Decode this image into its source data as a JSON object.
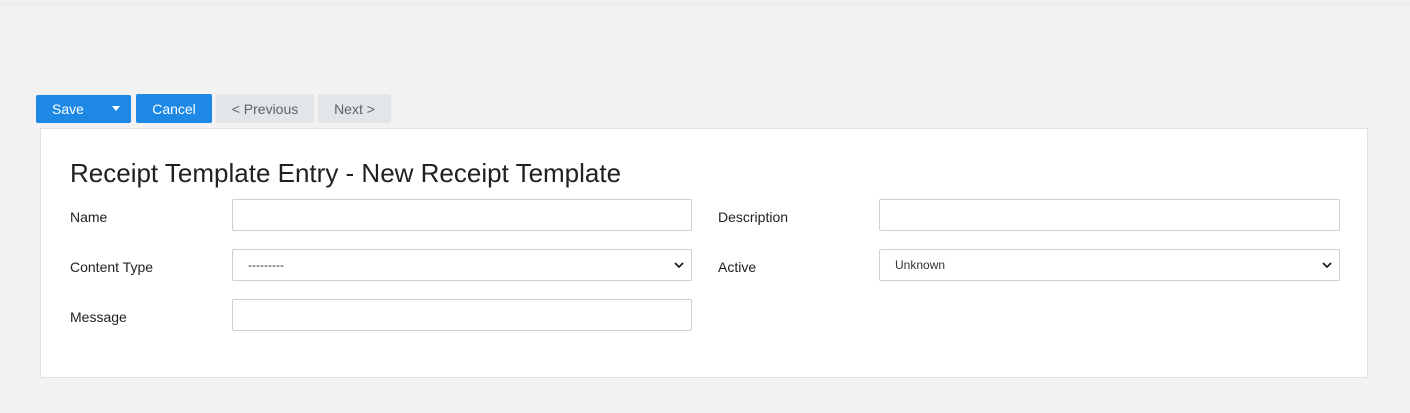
{
  "toolbar": {
    "save_label": "Save",
    "cancel_label": "Cancel",
    "previous_label": "< Previous",
    "next_label": "Next >"
  },
  "form": {
    "title": "Receipt Template Entry - New Receipt Template",
    "fields": {
      "name": {
        "label": "Name",
        "value": ""
      },
      "description": {
        "label": "Description",
        "value": ""
      },
      "content_type": {
        "label": "Content Type",
        "selected": "---------"
      },
      "active": {
        "label": "Active",
        "selected": "Unknown"
      },
      "message": {
        "label": "Message",
        "value": ""
      }
    }
  },
  "colors": {
    "primary": "#1e88e5",
    "default_button": "#e3e6e9",
    "page_background": "#f2f2f2"
  },
  "icons": {
    "dropdown": "chevron-down-icon",
    "save_menu": "caret-down-icon"
  }
}
